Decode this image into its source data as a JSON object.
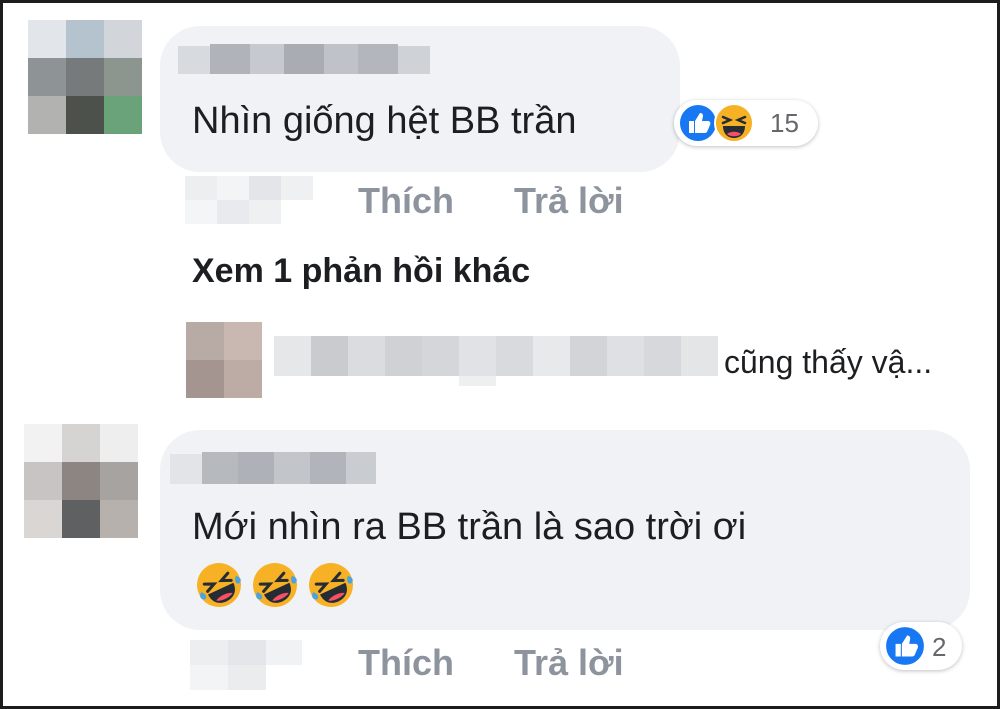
{
  "comments": [
    {
      "text": "Nhìn giống hệt BB trần",
      "reactions": {
        "count": "15",
        "icons": [
          "like-icon",
          "haha-icon"
        ]
      },
      "actions": {
        "like": "Thích",
        "reply": "Trả lời"
      },
      "more_replies": "Xem 1 phản hồi khác",
      "reply_preview": "cũng thấy vậ..."
    },
    {
      "text": "Mới nhìn ra BB trần là sao trời ơi",
      "emoji": [
        "rofl-icon",
        "rofl-icon",
        "rofl-icon"
      ],
      "reactions": {
        "count": "2",
        "icons": [
          "like-icon"
        ]
      },
      "actions": {
        "like": "Thích",
        "reply": "Trả lời"
      }
    }
  ],
  "colors": {
    "bubble": "#f0f2f5",
    "like_blue": "#1877f2",
    "haha_yellow": "#f7b125",
    "muted": "#8d949e"
  }
}
